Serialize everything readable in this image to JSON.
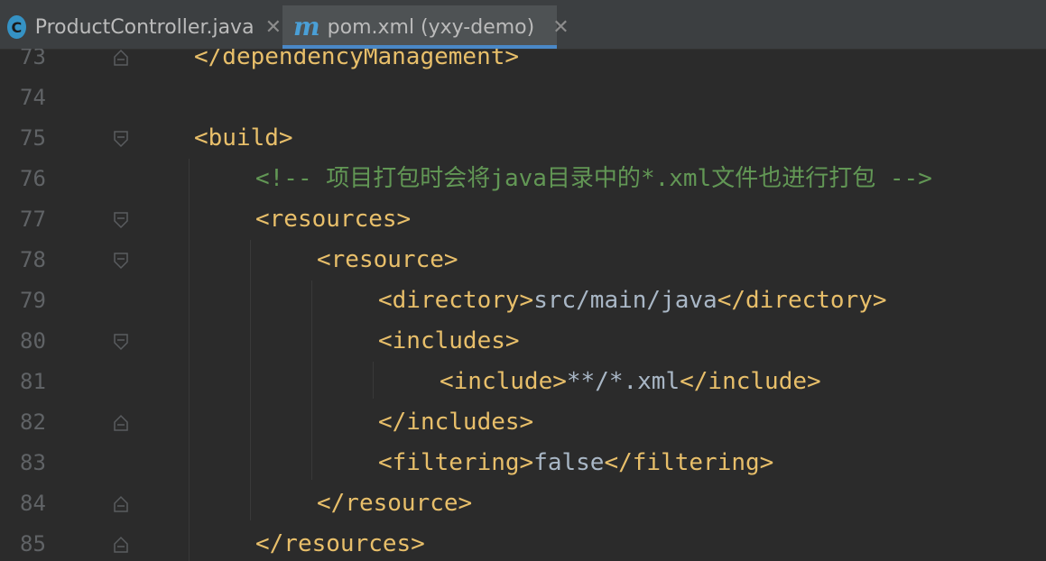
{
  "tabs": [
    {
      "icon": "class-icon",
      "icon_text": "C",
      "label": "ProductController.java",
      "active": false
    },
    {
      "icon": "maven-icon",
      "icon_text": "m",
      "label": "pom.xml (yxy-demo)",
      "active": true
    }
  ],
  "colors": {
    "background": "#2b2b2b",
    "tag": "#e8bf6a",
    "text": "#a9b7c6",
    "comment": "#629755",
    "line_number": "#606366",
    "tab_accent": "#4a88c7"
  },
  "lines": [
    {
      "number": "73",
      "fold": "end"
    },
    {
      "number": "74",
      "fold": "none"
    },
    {
      "number": "75",
      "fold": "start"
    },
    {
      "number": "76",
      "fold": "none"
    },
    {
      "number": "77",
      "fold": "start"
    },
    {
      "number": "78",
      "fold": "start"
    },
    {
      "number": "79",
      "fold": "none"
    },
    {
      "number": "80",
      "fold": "start"
    },
    {
      "number": "81",
      "fold": "none"
    },
    {
      "number": "82",
      "fold": "end"
    },
    {
      "number": "83",
      "fold": "none"
    },
    {
      "number": "84",
      "fold": "end"
    },
    {
      "number": "85",
      "fold": "end"
    }
  ],
  "code": {
    "l73": {
      "tag": "</dependencyManagement>"
    },
    "l75": {
      "tag": "<build>"
    },
    "l76": {
      "open": "<!-- ",
      "c1": "项目打包时会将",
      "m1": "java",
      "c2": "目录中的",
      "m2": "*.xml",
      "c3": "文件也进行打包",
      "close": " -->"
    },
    "l77": {
      "tag": "<resources>"
    },
    "l78": {
      "tag": "<resource>"
    },
    "l79": {
      "open": "<directory>",
      "value": "src/main/java",
      "close": "</directory>"
    },
    "l80": {
      "tag": "<includes>"
    },
    "l81": {
      "open": "<include>",
      "value": "**/*.xml",
      "close": "</include>"
    },
    "l82": {
      "tag": "</includes>"
    },
    "l83": {
      "open": "<filtering>",
      "value": "false",
      "close": "</filtering>"
    },
    "l84": {
      "tag": "</resource>"
    },
    "l85": {
      "tag": "</resources>"
    }
  }
}
